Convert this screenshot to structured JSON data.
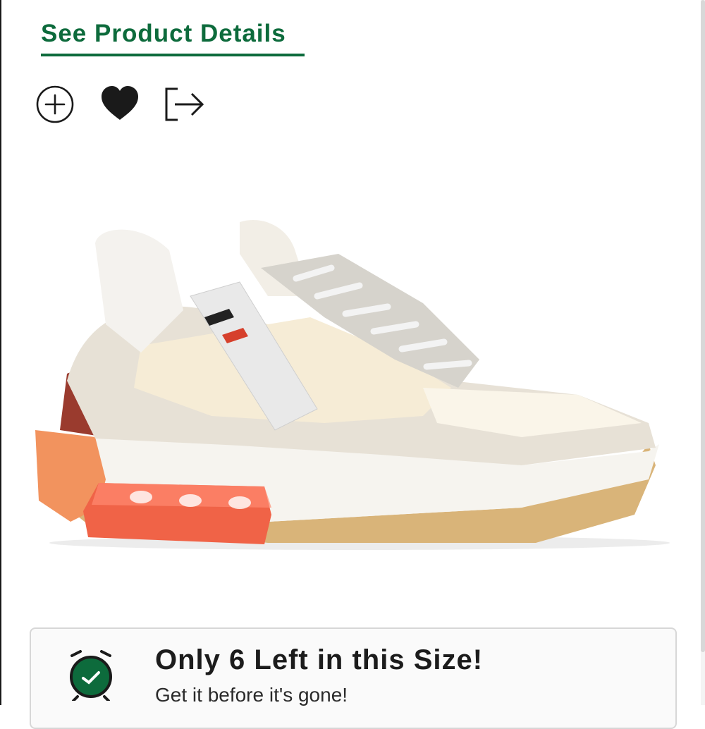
{
  "product_details_link": {
    "label": "See Product Details"
  },
  "actions": {
    "add": {
      "icon": "plus-circle-icon"
    },
    "favorite": {
      "icon": "heart-icon"
    },
    "share": {
      "icon": "share-arrow-icon"
    }
  },
  "product_image": {
    "icon": "sneaker-image"
  },
  "stock_alert": {
    "title": "Only 6 Left in this Size!",
    "subtitle": "Get it before it's gone!",
    "icon": "alarm-clock-icon",
    "accent_color": "#0d6b3c"
  },
  "colors": {
    "brand_green": "#0d6b3c",
    "text_dark": "#1c1c1c"
  }
}
